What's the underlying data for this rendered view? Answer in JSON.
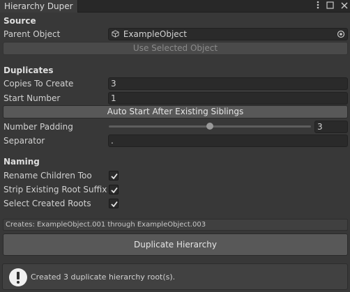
{
  "window": {
    "tab_title": "Hierarchy Duper",
    "icons": [
      "kebab-menu-icon",
      "maximize-icon",
      "close-icon"
    ]
  },
  "source": {
    "heading": "Source",
    "parent_label": "Parent Object",
    "parent_value": "ExampleObject",
    "use_selected_label": "Use Selected Object"
  },
  "duplicates": {
    "heading": "Duplicates",
    "copies_label": "Copies To Create",
    "copies_value": "3",
    "start_label": "Start Number",
    "start_value": "1",
    "auto_start_label": "Auto Start After Existing Siblings",
    "padding_label": "Number Padding",
    "padding_value": "3",
    "padding_slider_fraction": 0.5,
    "separator_label": "Separator",
    "separator_value": "."
  },
  "naming": {
    "heading": "Naming",
    "rename_children_label": "Rename Children Too",
    "rename_children_checked": true,
    "strip_suffix_label": "Strip Existing Root Suffix",
    "strip_suffix_checked": true,
    "select_roots_label": "Select Created Roots",
    "select_roots_checked": true
  },
  "summary": {
    "creates_text": "Creates: ExampleObject.001 through ExampleObject.003",
    "duplicate_button_label": "Duplicate Hierarchy",
    "info_message": "Created 3 duplicate hierarchy root(s)."
  }
}
